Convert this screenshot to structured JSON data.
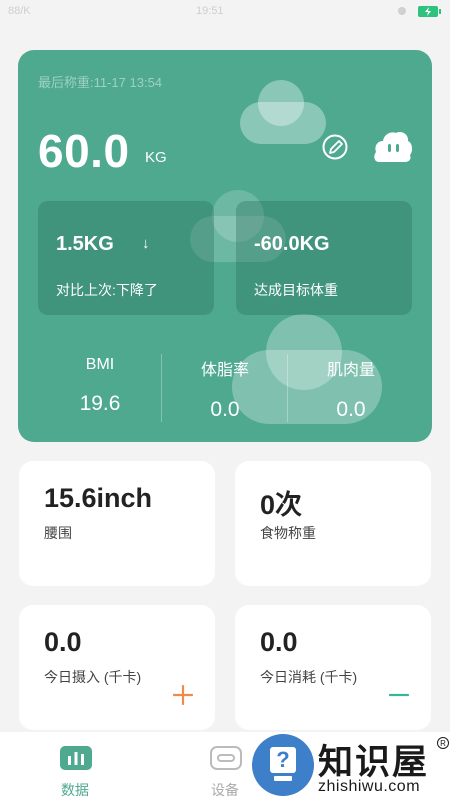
{
  "status_bar": {
    "left": "88/K",
    "center": "19:51"
  },
  "hero": {
    "last_weigh": "最后称重:11-17 13:54",
    "weight_value": "60.0",
    "weight_unit": "KG",
    "stats": [
      {
        "value": "1.5KG",
        "label": "对比上次:下降了",
        "arrow": "↓"
      },
      {
        "value": "-60.0KG",
        "label": "达成目标体重"
      }
    ],
    "metrics": [
      {
        "label": "BMI",
        "value": "19.6"
      },
      {
        "label": "体脂率",
        "value": "0.0"
      },
      {
        "label": "肌肉量",
        "value": "0.0"
      }
    ]
  },
  "cards": [
    {
      "value": "15.6inch",
      "label": "腰围"
    },
    {
      "value": "0次",
      "label": "食物称重"
    },
    {
      "value": "0.0",
      "label": "今日摄入 (千卡)"
    },
    {
      "value": "0.0",
      "label": "今日消耗 (千卡)"
    }
  ],
  "tabs": [
    {
      "label": "数据",
      "icon": "chart-bars-icon"
    },
    {
      "label": "设备",
      "icon": "link-icon"
    }
  ],
  "watermark": {
    "cn": "知识屋",
    "en": "zhishiwu.com",
    "mark": "R",
    "q": "?"
  },
  "colors": {
    "accent": "#4ea98f",
    "plus": "#f08a4b",
    "minus": "#3bb59a"
  }
}
